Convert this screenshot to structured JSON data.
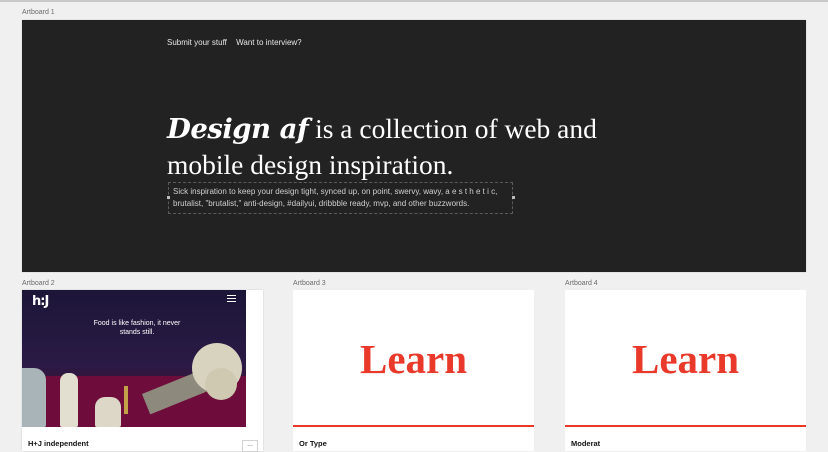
{
  "artboards": {
    "ab1_label": "Artboard 1",
    "ab2_label": "Artboard 2",
    "ab3_label": "Artboard 3",
    "ab4_label": "Artboard 4"
  },
  "hero": {
    "nav": [
      "Submit your stuff",
      "Want to interview?"
    ],
    "headline_brand": "Design af",
    "headline_rest_line1": " is a collection of web and",
    "headline_line2": "mobile design inspiration.",
    "subtext": "Sick inspiration to keep your design tight, synced up, on point, swervy, wavy, a e s t h e t i c, brutalist, \"brutalist,\" anti-design, #dailyui, dribbble ready, mvp, and other buzzwords."
  },
  "cards": [
    {
      "logo": "h:J",
      "tagline": "Food is like fashion, it never stands still.",
      "title": "H+J independent",
      "more": "..."
    },
    {
      "hero_text": "Learn",
      "title": "Or Type"
    },
    {
      "hero_text": "Learn",
      "title": "Moderat"
    }
  ],
  "colors": {
    "dark_board": "#222222",
    "accent_red": "#e8392b",
    "canvas": "#f0f0f0"
  }
}
